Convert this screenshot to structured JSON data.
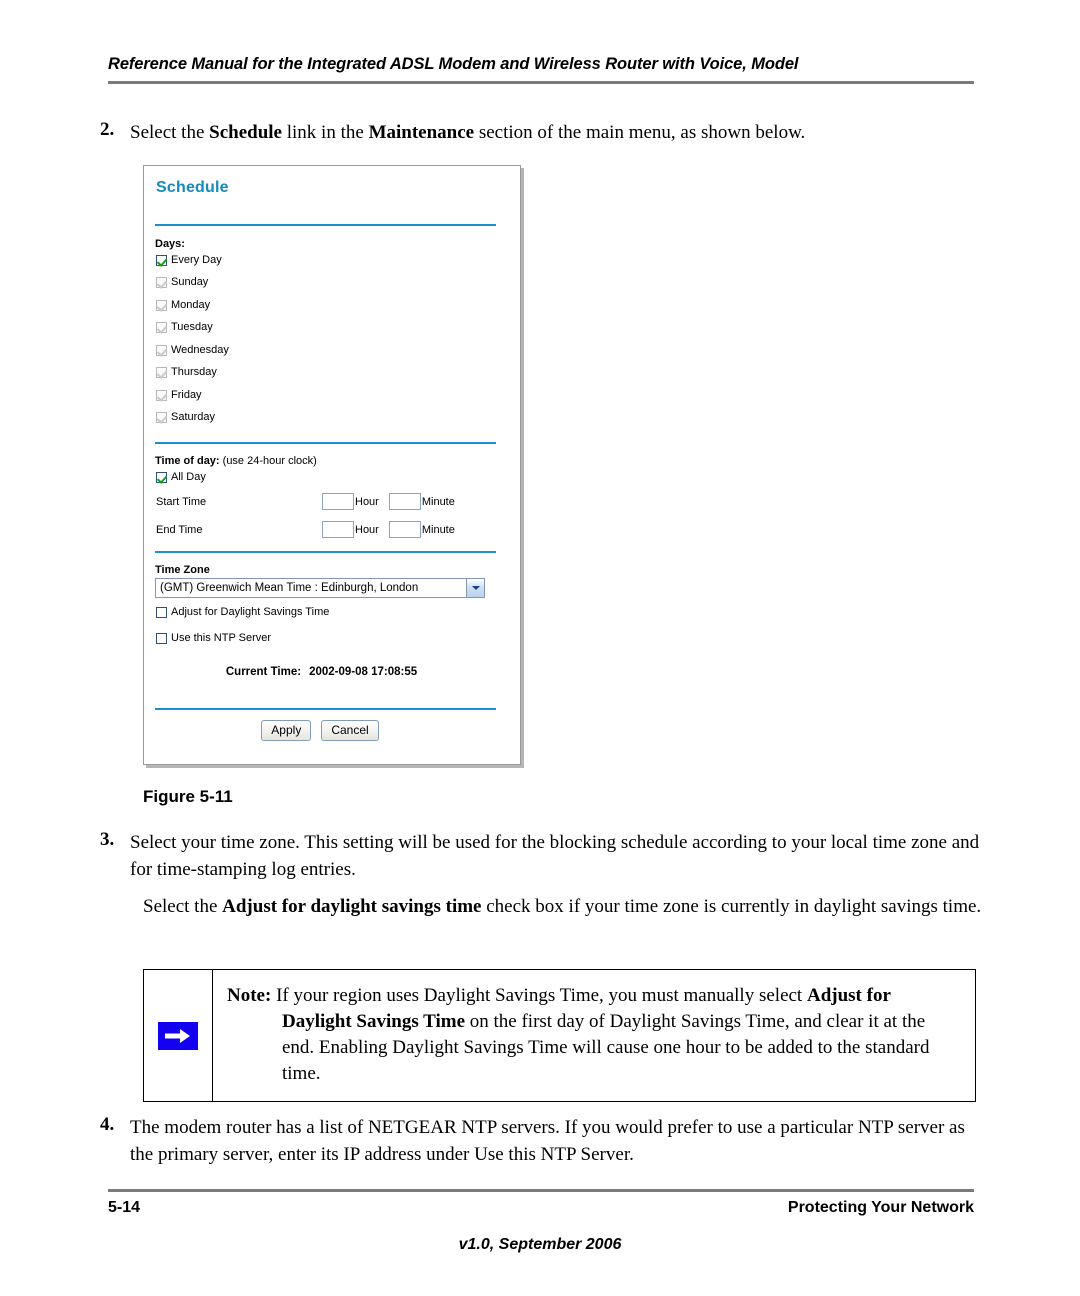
{
  "header": {
    "title": "Reference Manual for the Integrated ADSL Modem and Wireless Router with Voice, Model"
  },
  "steps": {
    "step2": {
      "number": "2.",
      "text_a": "Select the ",
      "bold_a": "Schedule",
      "text_b": " link in the ",
      "bold_b": "Maintenance",
      "text_c": " section of the main menu, as shown below."
    },
    "step3": {
      "number": "3.",
      "text": "Select your time zone. This setting will be used for the blocking schedule according to your local time zone and for time-stamping log entries.",
      "para_a": "Select the ",
      "para_bold": "Adjust for daylight savings time",
      "para_b": " check box if your time zone is currently in daylight savings time."
    },
    "step4": {
      "number": "4.",
      "text": "The modem router has a list of NETGEAR NTP servers. If you would prefer to use a particular NTP server as the primary server, enter its IP address under Use this NTP Server."
    }
  },
  "figure": {
    "caption": "Figure 5-11"
  },
  "screenshot": {
    "title": "Schedule",
    "days": {
      "label": "Days:",
      "items": [
        {
          "label": "Every Day",
          "checked": true,
          "disabled": false
        },
        {
          "label": "Sunday",
          "checked": true,
          "disabled": true
        },
        {
          "label": "Monday",
          "checked": true,
          "disabled": true
        },
        {
          "label": "Tuesday",
          "checked": true,
          "disabled": true
        },
        {
          "label": "Wednesday",
          "checked": true,
          "disabled": true
        },
        {
          "label": "Thursday",
          "checked": true,
          "disabled": true
        },
        {
          "label": "Friday",
          "checked": true,
          "disabled": true
        },
        {
          "label": "Saturday",
          "checked": true,
          "disabled": true
        }
      ]
    },
    "time_of_day": {
      "label": "Time of day:",
      "note": "(use 24-hour clock)",
      "all_day_label": "All Day",
      "all_day_checked": true,
      "start_time_label": "Start Time",
      "end_time_label": "End Time",
      "hour_unit": "Hour",
      "minute_unit": "Minute",
      "start_hour": "",
      "start_minute": "",
      "end_hour": "",
      "end_minute": ""
    },
    "time_zone": {
      "label": "Time Zone",
      "selected": "(GMT) Greenwich Mean Time : Edinburgh, London",
      "adjust_dst_label": "Adjust for Daylight Savings Time",
      "adjust_dst_checked": false,
      "ntp_label": "Use this NTP Server",
      "ntp_checked": false,
      "ntp_octets": [
        "",
        "",
        "",
        ""
      ],
      "ntp_separator": "."
    },
    "current_time": {
      "label": "Current Time:",
      "value": "2002-09-08 17:08:55"
    },
    "buttons": {
      "apply": "Apply",
      "cancel": "Cancel"
    },
    "colors": {
      "title_blue": "#1789bd",
      "rule_blue": "#1b8fd0",
      "check_green": "#13a013"
    }
  },
  "note": {
    "label": "Note:",
    "line1_a": " If your region uses Daylight Savings Time, you must manually select ",
    "bold1": "Adjust for Daylight Savings Time",
    "line1_b": " on the first day of Daylight Savings Time, and clear it at the end. Enabling Daylight Savings Time will cause one hour to be added to the standard time.",
    "icon_color": "#1400f0"
  },
  "footer": {
    "page_number": "5-14",
    "section": "Protecting Your Network",
    "version": "v1.0, September 2006"
  }
}
